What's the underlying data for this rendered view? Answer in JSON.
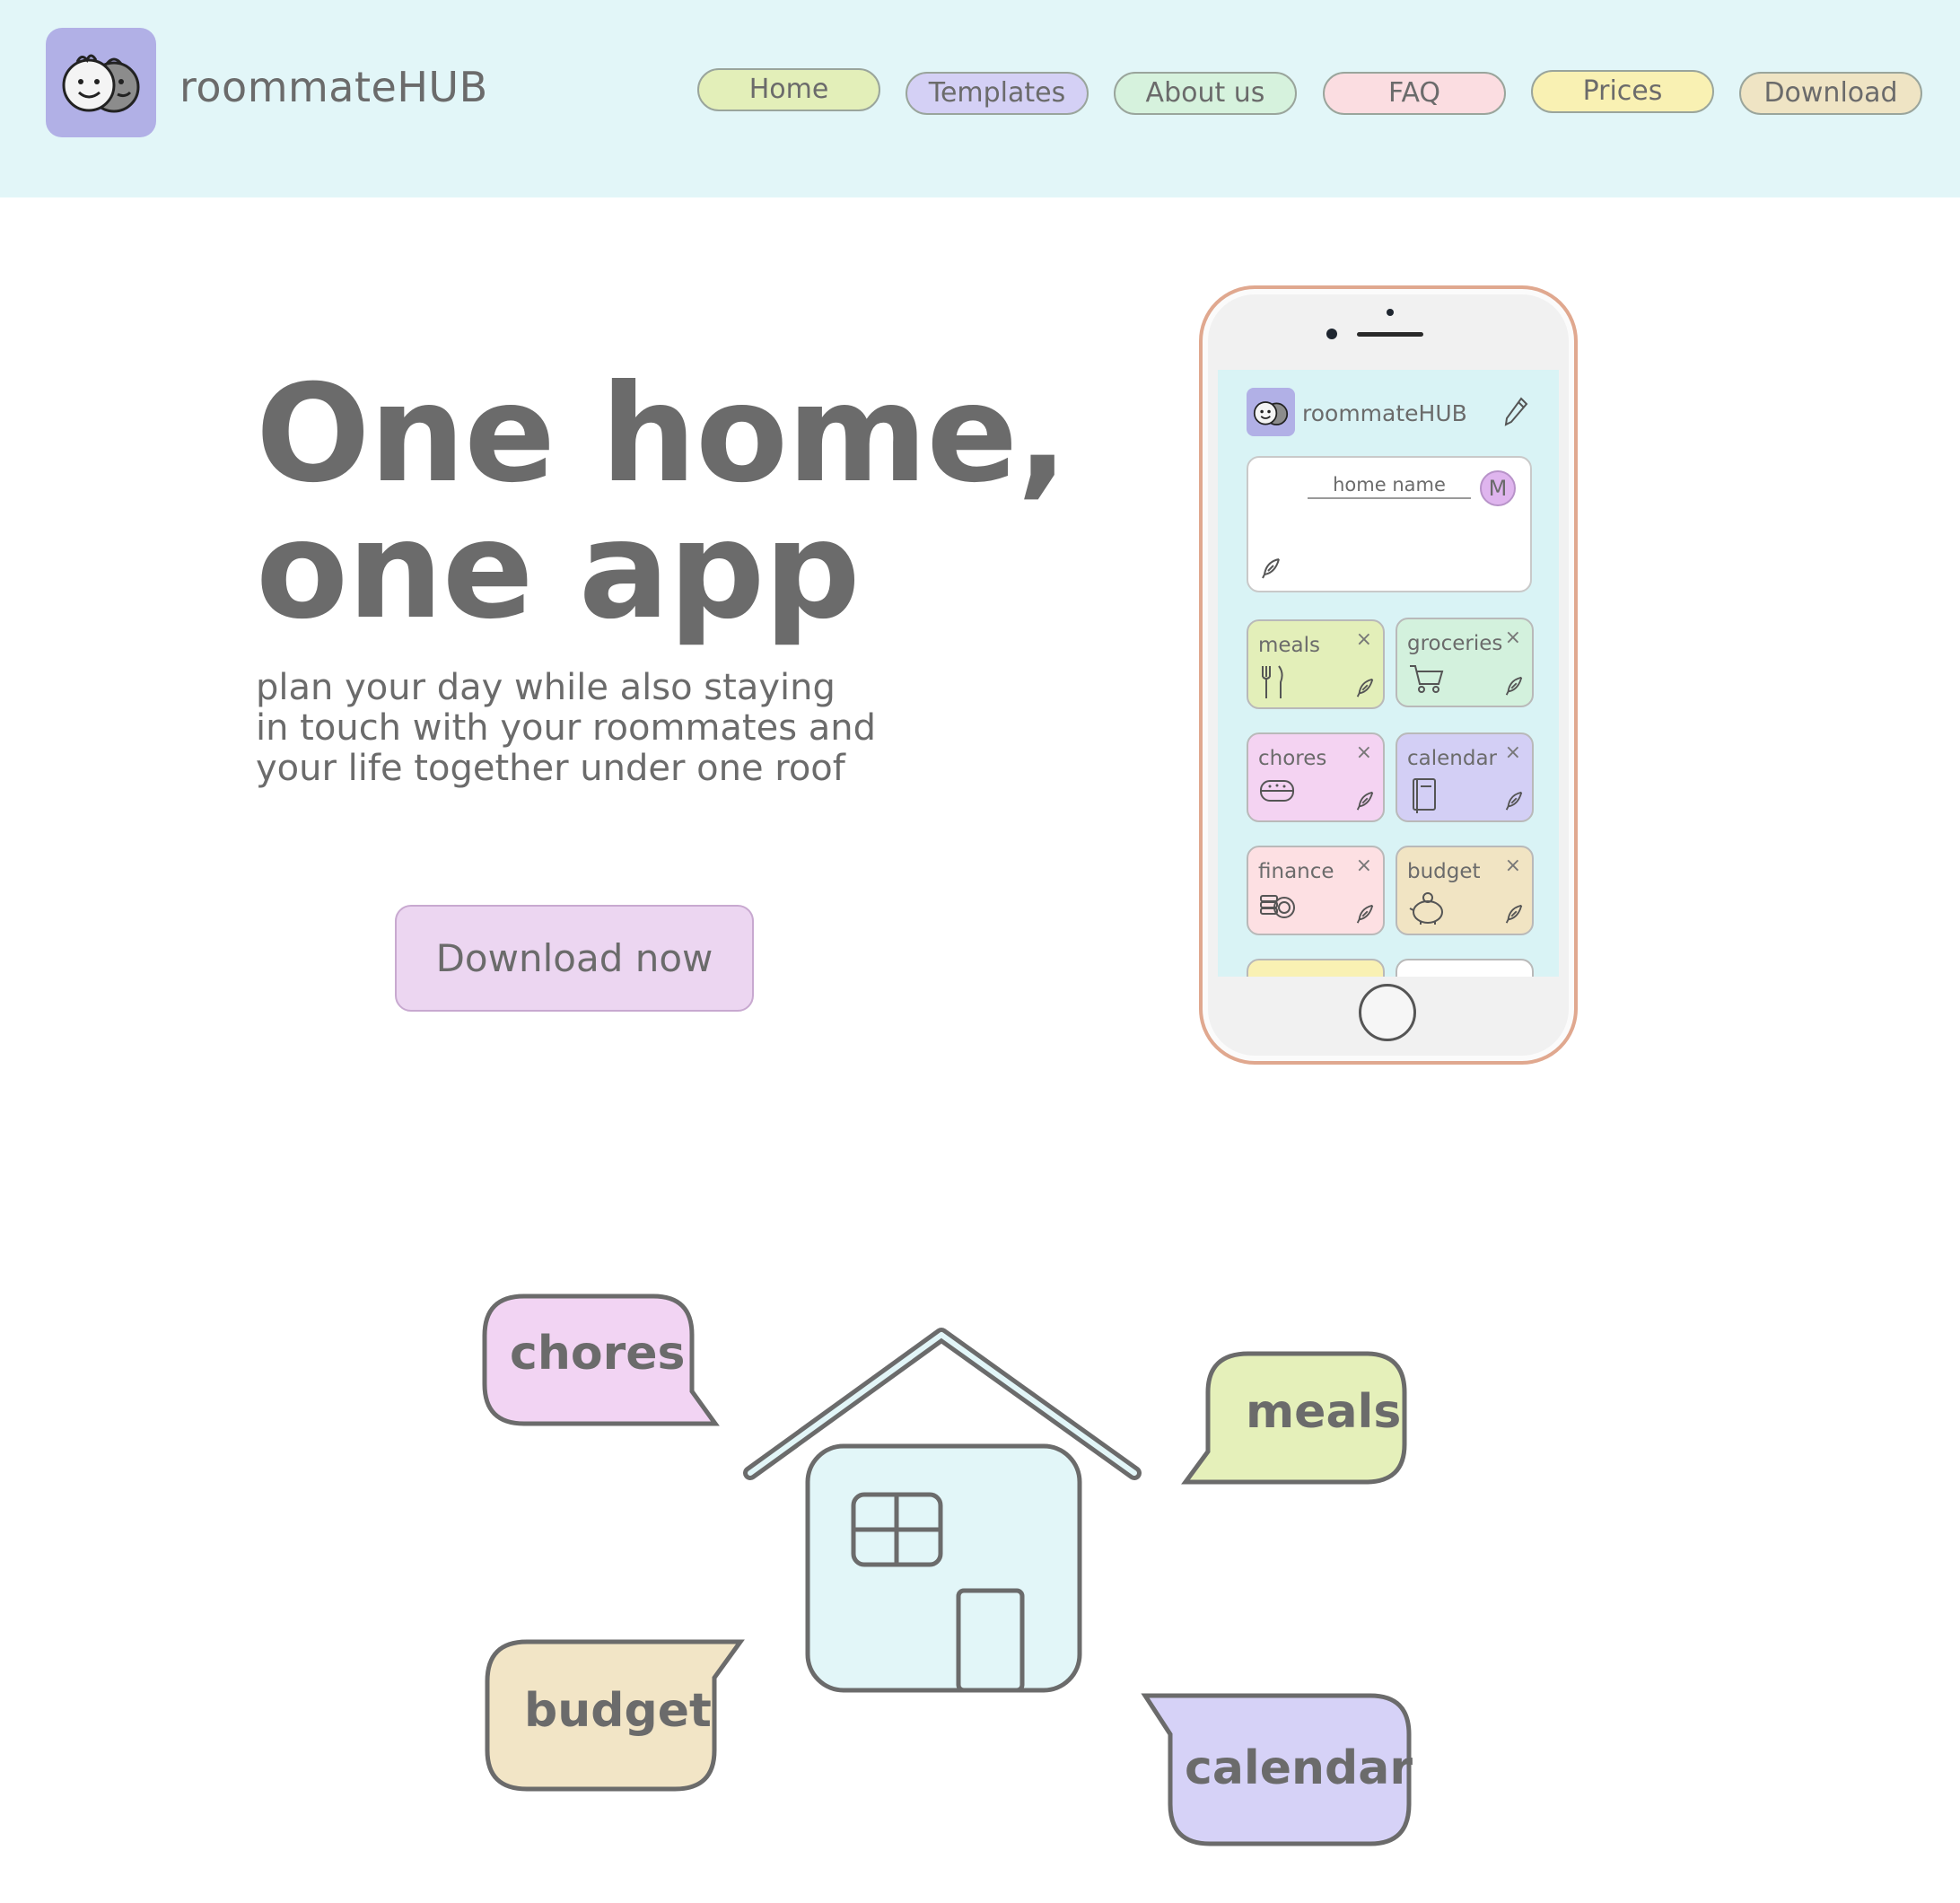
{
  "header": {
    "brand": "roommateHUB",
    "logo_icon": "roommates-faces-icon",
    "nav": [
      {
        "label": "Home",
        "color": "#e3efb9"
      },
      {
        "label": "Templates",
        "color": "#d4d0f5"
      },
      {
        "label": "About us",
        "color": "#d6f2dd"
      },
      {
        "label": "FAQ",
        "color": "#fbdde1"
      },
      {
        "label": "Prices",
        "color": "#f9f1b3"
      },
      {
        "label": "Download",
        "color": "#efe4c4"
      }
    ]
  },
  "hero": {
    "title_line1": "One home,",
    "title_line2": "one app",
    "subtitle_line1": "plan your day while also staying",
    "subtitle_line2": "in touch with your roommates and",
    "subtitle_line3": "your life together under one roof",
    "cta_label": "Download now"
  },
  "phone": {
    "brand": "roommateHUB",
    "home_name_placeholder": "home name",
    "avatar_initial": "M",
    "tiles": [
      {
        "label": "meals",
        "icon": "fork-knife-icon",
        "color": "#e3efb9"
      },
      {
        "label": "groceries",
        "icon": "shopping-cart-icon",
        "color": "#d3f1dd"
      },
      {
        "label": "chores",
        "icon": "sponge-icon",
        "color": "#f4d3f2"
      },
      {
        "label": "calendar",
        "icon": "notebook-icon",
        "color": "#d3cff5"
      },
      {
        "label": "finance",
        "icon": "coins-icon",
        "color": "#fde0e3"
      },
      {
        "label": "budget",
        "icon": "piggy-bank-icon",
        "color": "#f1e4c3"
      }
    ],
    "close_symbol": "×"
  },
  "illustration": {
    "bubbles": [
      {
        "label": "chores",
        "color": "#f2d4f3"
      },
      {
        "label": "meals",
        "color": "#e5f0ba"
      },
      {
        "label": "budget",
        "color": "#f2e5c6"
      },
      {
        "label": "calendar",
        "color": "#d6d2f7"
      }
    ],
    "house_color": "#e2f6f8"
  }
}
